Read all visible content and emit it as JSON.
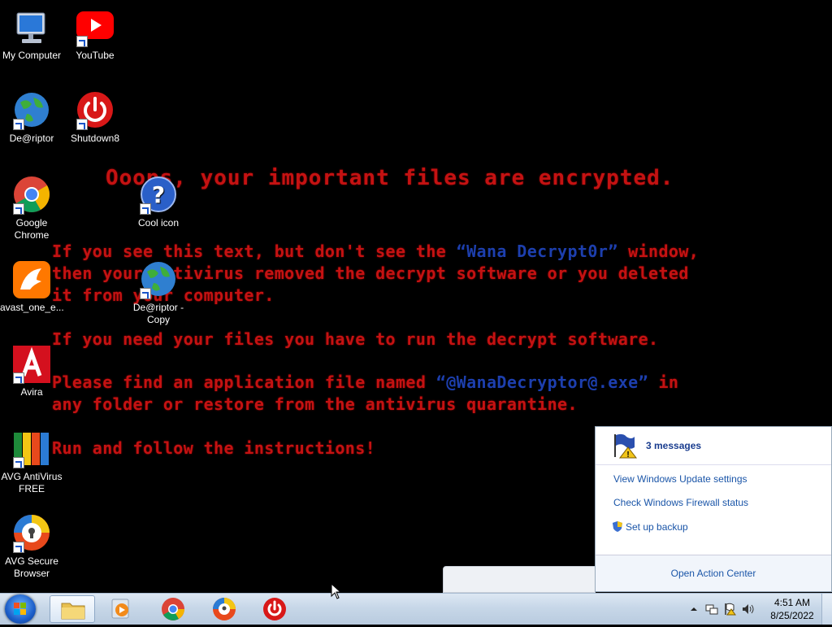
{
  "wallpaper": {
    "title": "Ooops, your important files are encrypted.",
    "line1_a": "If you see this text, but don't see the ",
    "line1_b": "“Wana Decrypt0r”",
    "line1_c": " window,",
    "line2": "then your antivirus removed the decrypt software or you deleted",
    "line3": "it from your computer.",
    "line4": "If you need your files you have to run the decrypt software.",
    "line5_a": "Please find an application file named ",
    "line5_b": "“@WanaDecryptor@.exe”",
    "line5_c": " in",
    "line6": "any folder or restore from the antivirus quarantine.",
    "line7": "Run and follow the instructions!"
  },
  "desktop_icons": {
    "my_computer": "My Computer",
    "youtube": "YouTube",
    "decriptor": "De@riptor",
    "shutdown8": "Shutdown8",
    "chrome": "Google Chrome",
    "cool_icon": "Cool icon",
    "avast": "avast_one_e...",
    "decriptor_copy": "De@riptor - Copy",
    "avira": "Avira",
    "avg_av": "AVG AntiVirus FREE",
    "avg_browser": "AVG Secure Browser"
  },
  "action_center": {
    "header": "3 messages",
    "links": [
      "View Windows Update settings",
      "Check Windows Firewall status",
      "Set up backup"
    ],
    "footer": "Open Action Center"
  },
  "taskbar": {
    "time": "4:51 AM",
    "date": "8/25/2022"
  },
  "colors": {
    "ransom_red": "#c41212",
    "ransom_blue": "#1d3fae",
    "link_blue": "#1a55a8"
  }
}
